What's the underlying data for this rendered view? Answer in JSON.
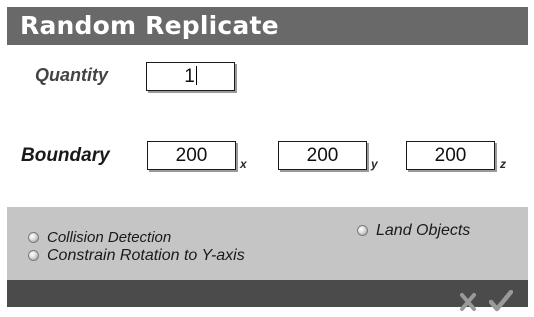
{
  "dialog": {
    "title": "Random Replicate"
  },
  "quantity": {
    "label": "Quantity",
    "value": "1"
  },
  "boundary": {
    "label": "Boundary",
    "x": {
      "value": "200",
      "axis": "x"
    },
    "y": {
      "value": "200",
      "axis": "y"
    },
    "z": {
      "value": "200",
      "axis": "z"
    }
  },
  "options": {
    "collision_detection": {
      "label": "Collision Detection",
      "checked": false
    },
    "constrain_rotation": {
      "label": "Constrain Rotation to Y-axis",
      "checked": false
    },
    "land_objects": {
      "label": "Land Objects",
      "checked": false
    }
  },
  "footer": {
    "cancel_icon": "x-icon",
    "ok_icon": "checkmark-icon"
  },
  "colors": {
    "titlebar": "#696969",
    "options_panel": "#c5c5c5",
    "footer": "#4b4b4b",
    "footer_icons": "#9a9a9a"
  }
}
